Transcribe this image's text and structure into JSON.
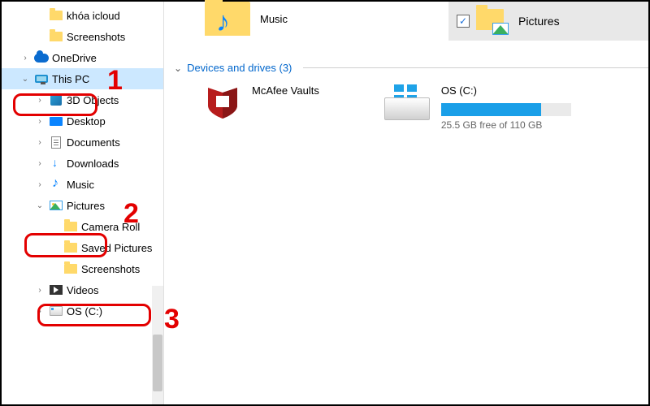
{
  "sidebar": {
    "items": [
      {
        "label": "khóa icloud",
        "icon": "folder",
        "indent": 2,
        "exp": ""
      },
      {
        "label": "Screenshots",
        "icon": "folder",
        "indent": 2,
        "exp": ""
      },
      {
        "label": "OneDrive",
        "icon": "cloud",
        "indent": 1,
        "exp": ">"
      },
      {
        "label": "This PC",
        "icon": "monitor",
        "indent": 1,
        "exp": "v",
        "selected": true
      },
      {
        "label": "3D Objects",
        "icon": "cube",
        "indent": 2,
        "exp": ">"
      },
      {
        "label": "Desktop",
        "icon": "desk",
        "indent": 2,
        "exp": ">"
      },
      {
        "label": "Documents",
        "icon": "doc",
        "indent": 2,
        "exp": ">"
      },
      {
        "label": "Downloads",
        "icon": "dl",
        "indent": 2,
        "exp": ">"
      },
      {
        "label": "Music",
        "icon": "note",
        "indent": 2,
        "exp": ">"
      },
      {
        "label": "Pictures",
        "icon": "pic",
        "indent": 2,
        "exp": "v"
      },
      {
        "label": "Camera Roll",
        "icon": "folder",
        "indent": 3,
        "exp": ""
      },
      {
        "label": "Saved Pictures",
        "icon": "folder",
        "indent": 3,
        "exp": ""
      },
      {
        "label": "Screenshots",
        "icon": "folder",
        "indent": 3,
        "exp": ""
      },
      {
        "label": "Videos",
        "icon": "vid",
        "indent": 2,
        "exp": ">"
      },
      {
        "label": "OS (C:)",
        "icon": "disk",
        "indent": 2,
        "exp": ">"
      }
    ]
  },
  "header": {
    "checked": "✓",
    "label": "Pictures"
  },
  "content": {
    "music_label": "Music",
    "group_title": "Devices and drives (3)",
    "mcafee_label": "McAfee Vaults",
    "os_drive": {
      "name": "OS (C:)",
      "free_text": "25.5 GB free of 110 GB",
      "fill_percent": 77
    }
  },
  "annotations": {
    "n1": "1",
    "n2": "2",
    "n3": "3"
  }
}
